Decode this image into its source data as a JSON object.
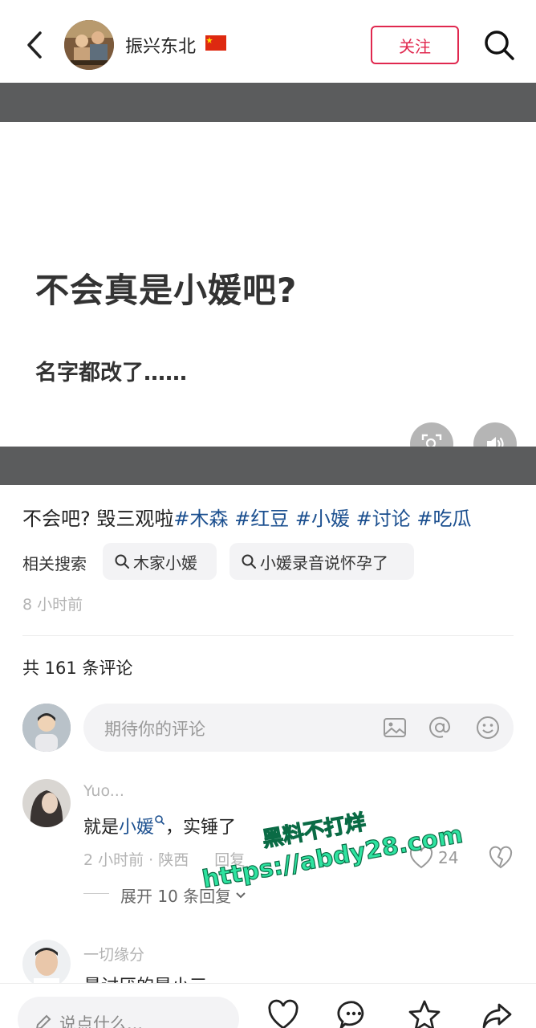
{
  "header": {
    "author_name": "振兴东北",
    "follow_label": "关注"
  },
  "post": {
    "title": "不会真是小媛吧?",
    "subtitle": "名字都改了……",
    "caption_text": "不会吧?  毁三观啦",
    "tags": [
      "#木森",
      "#红豆",
      "#小媛",
      "#讨论",
      "#吃瓜"
    ],
    "related_label": "相关搜索",
    "related_searches": [
      "木家小媛",
      "小媛录音说怀孕了"
    ],
    "time_ago": "8 小时前"
  },
  "comments": {
    "count_label": "共 161 条评论",
    "input_placeholder": "期待你的评论",
    "items": [
      {
        "author": "Yuo...",
        "text_prefix": "就是",
        "keyword": "小媛",
        "text_suffix": "，实锤了",
        "meta": "2 小时前 · 陕西",
        "reply_label": "回复",
        "likes": "24",
        "expand_label": "展开 10 条回复"
      },
      {
        "author": "一切缘分",
        "text": "最讨厌的是小三"
      }
    ]
  },
  "watermark": {
    "line1": "黑料不打烊",
    "line2": "https://abdy28.com"
  },
  "bottom_bar": {
    "placeholder": "说点什么..."
  },
  "colors": {
    "accent_red": "#e0284f",
    "tag_blue": "#1b4f8f",
    "band_gray": "#5b5c5d"
  }
}
